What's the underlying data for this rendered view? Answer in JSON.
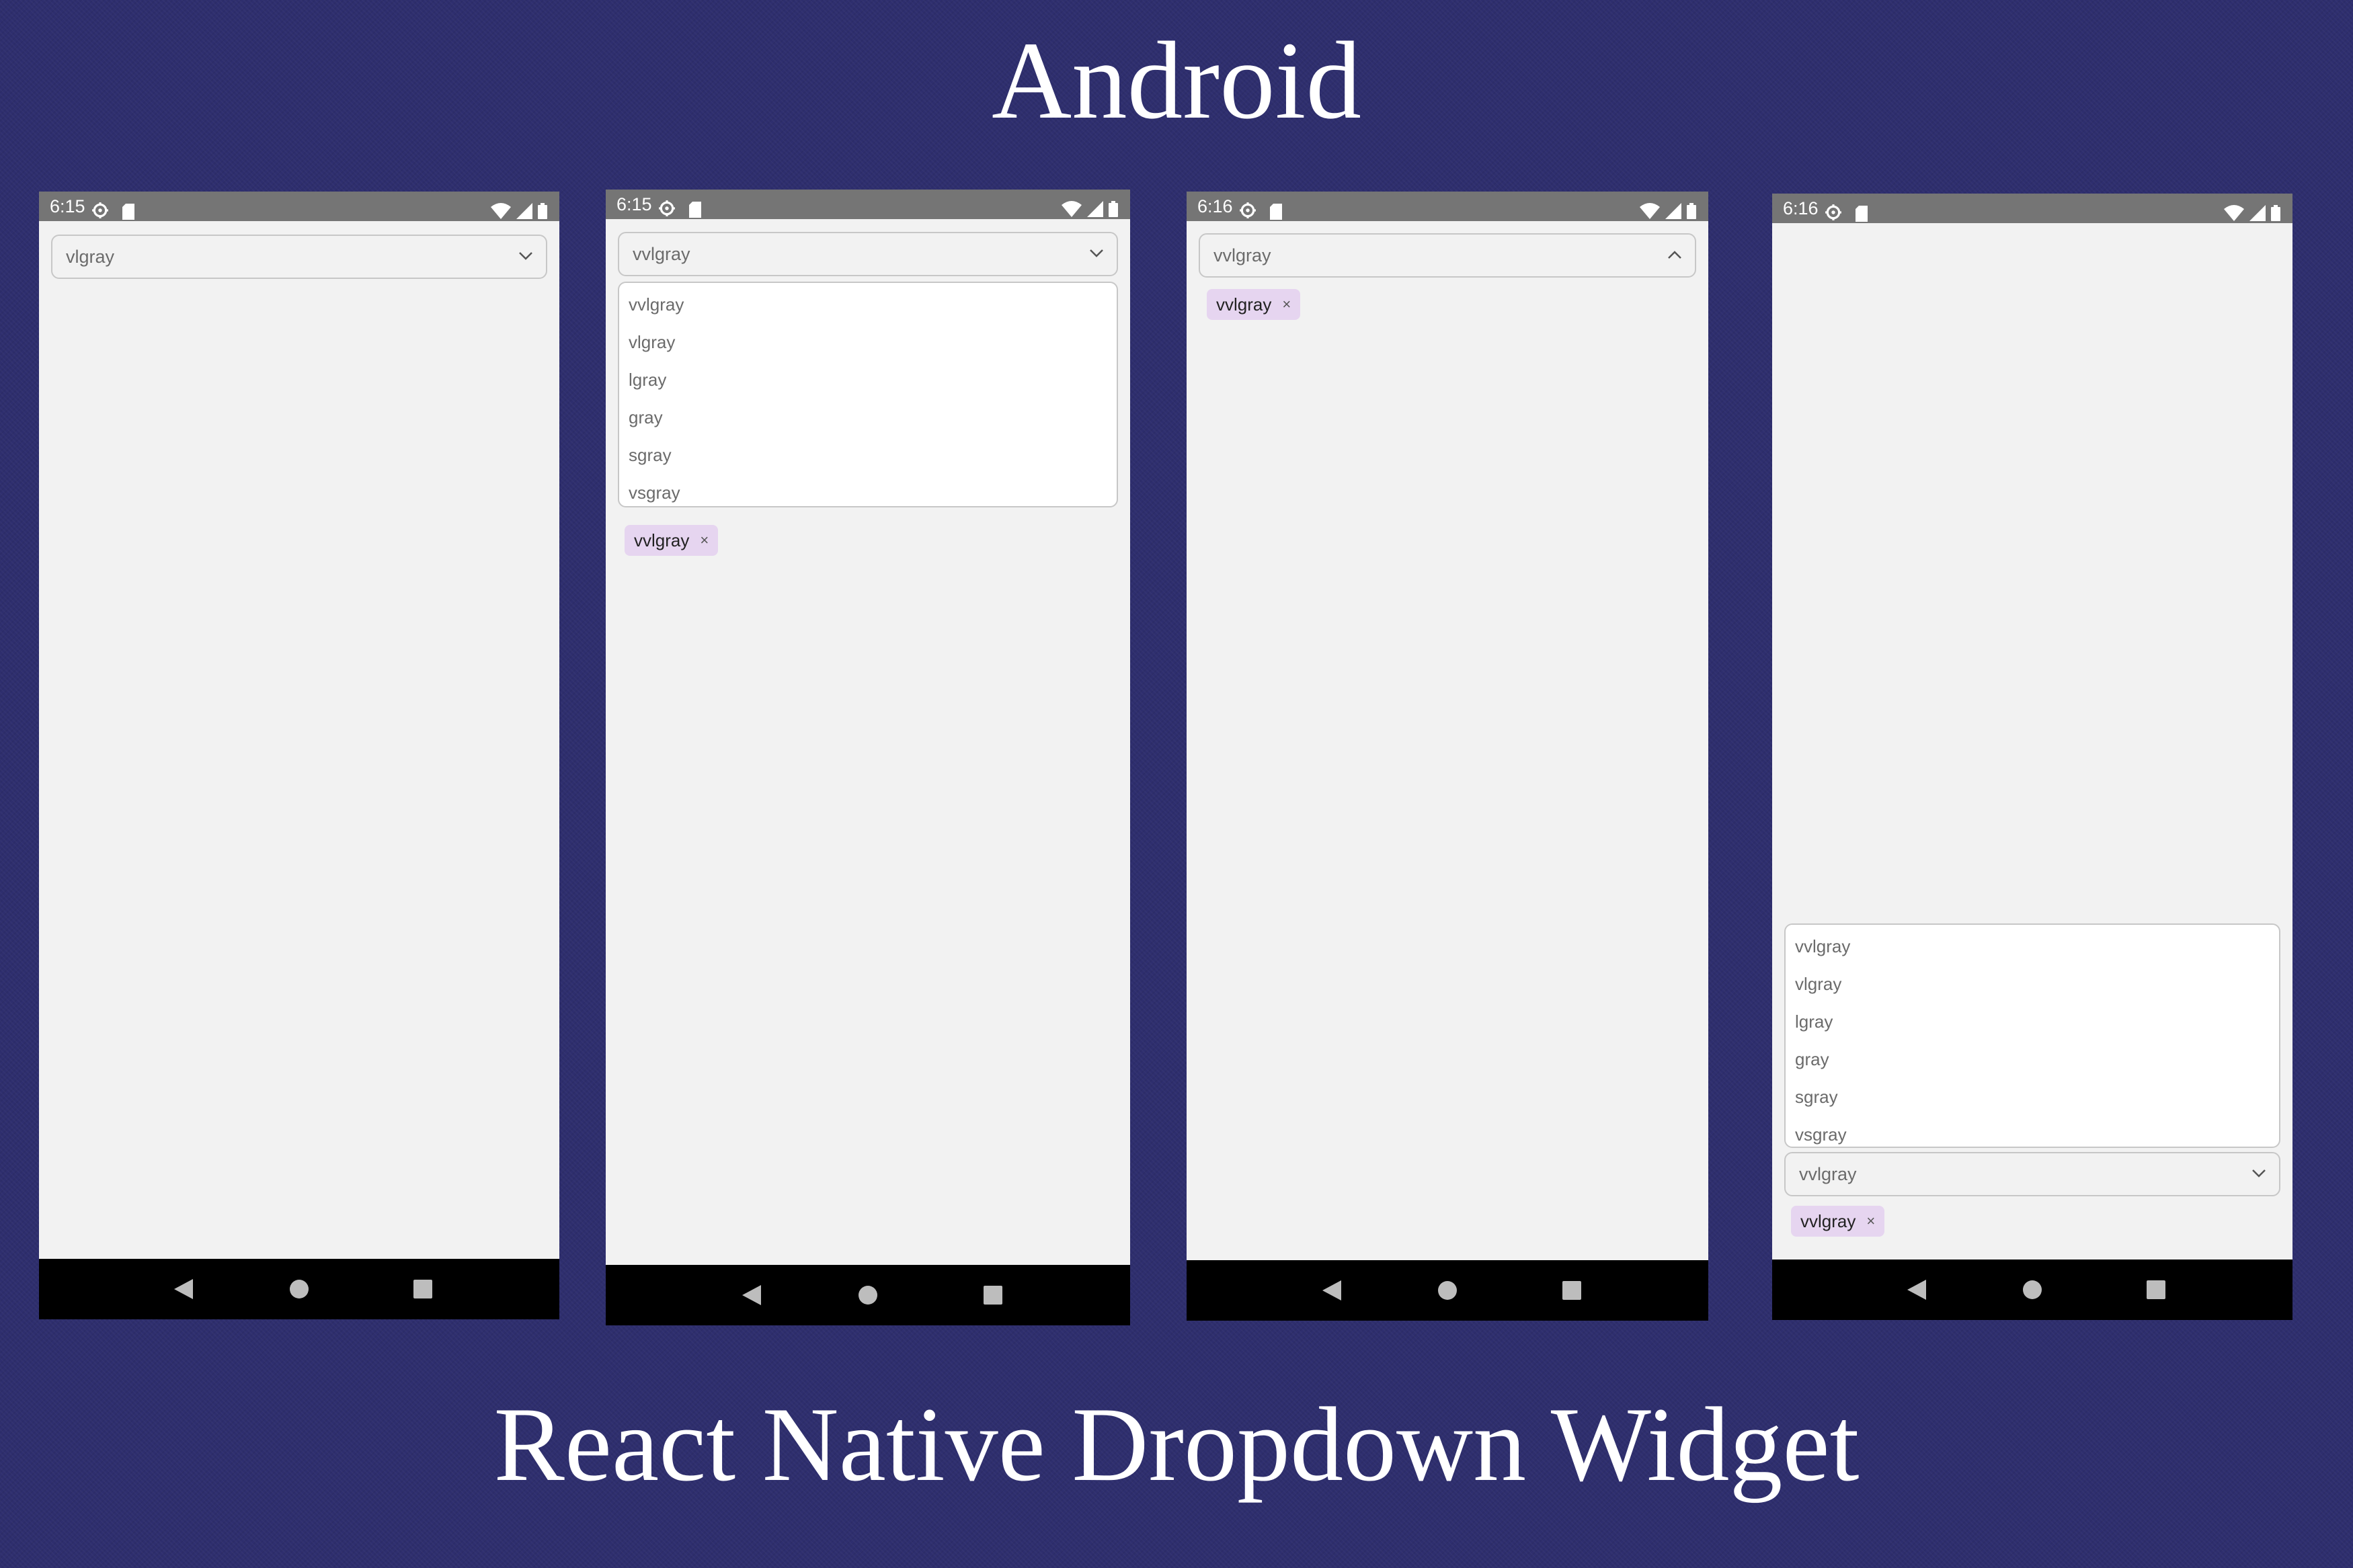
{
  "titles": {
    "top": "Android",
    "bottom": "React Native Dropdown Widget"
  },
  "icons": {
    "status_left": [
      "gear-icon",
      "sd-card-icon"
    ],
    "status_right": [
      "wifi-icon",
      "cell-signal-icon",
      "battery-icon"
    ],
    "nav": [
      "back-icon",
      "home-icon",
      "recents-icon"
    ],
    "dropdown_closed": "chevron-down-icon",
    "dropdown_open": "chevron-up-icon",
    "chip_remove": "close-icon"
  },
  "colors": {
    "background": "#2e2e6e",
    "status_bar": "#757575",
    "chip": "#e6d5f0"
  },
  "options": [
    "vvlgray",
    "vlgray",
    "lgray",
    "gray",
    "sgray",
    "vsgray"
  ],
  "phones": [
    {
      "time": "6:15",
      "dropdown_value": "vlgray"
    },
    {
      "time": "6:15",
      "dropdown_value": "vvlgray",
      "chip_label": "vvlgray",
      "chip_remove": "×"
    },
    {
      "time": "6:16",
      "dropdown_value": "vvlgray",
      "chip_label": "vvlgray",
      "chip_remove": "×"
    },
    {
      "time": "6:16",
      "dropdown_value": "vvlgray",
      "chip_label": "vvlgray",
      "chip_remove": "×"
    }
  ]
}
